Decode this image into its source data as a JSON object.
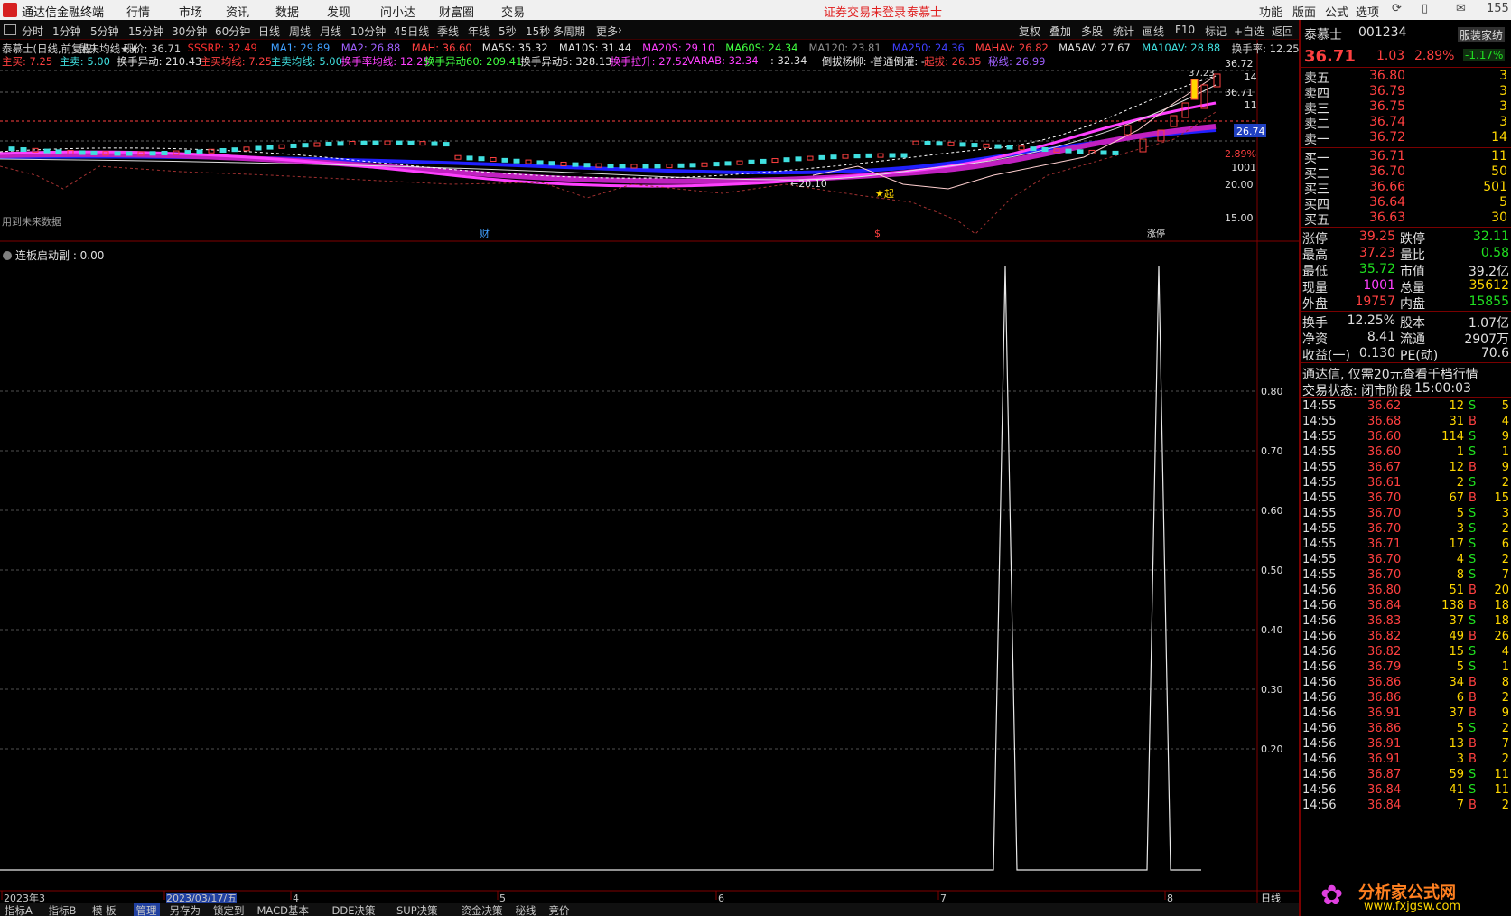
{
  "app": {
    "title": "通达信金融终端",
    "notice": "证券交易未登录",
    "user": "泰慕士",
    "corner": "155"
  },
  "menu": [
    "行情",
    "市场",
    "资讯",
    "数据",
    "发现",
    "问小达",
    "财富圈",
    "交易"
  ],
  "menu_right": [
    "功能",
    "版面",
    "公式",
    "选项"
  ],
  "periods": [
    "分时",
    "1分钟",
    "5分钟",
    "15分钟",
    "30分钟",
    "60分钟",
    "日线",
    "周线",
    "月线",
    "10分钟",
    "45日线",
    "季线",
    "年线",
    "5秒",
    "15秒",
    "多周期",
    "更多"
  ],
  "toolbar_right": [
    "复权",
    "叠加",
    "多股",
    "统计",
    "画线",
    "F10",
    "标记",
    "+自选",
    "返回"
  ],
  "main_chart": {
    "line1": [
      {
        "t": "泰慕士(日线,前复权)",
        "c": "#d0d0d0"
      },
      {
        "t": "鼠夫均线★★",
        "c": "#d0d0d0"
      },
      {
        "t": "现价: 36.71",
        "c": "#d0d0d0"
      },
      {
        "t": "SSSRP: 32.49",
        "c": "#ff3030"
      },
      {
        "t": "MA1: 29.89",
        "c": "#40a0ff"
      },
      {
        "t": "MA2: 26.88",
        "c": "#a060ff"
      },
      {
        "t": "MAH: 36.60",
        "c": "#ff4040"
      },
      {
        "t": "MA5S: 35.32",
        "c": "#e0e0e0"
      },
      {
        "t": "MA10S: 31.44",
        "c": "#e0e0e0"
      },
      {
        "t": "MA20S: 29.10",
        "c": "#ff40ff"
      },
      {
        "t": "MA60S: 24.34",
        "c": "#40ff40"
      },
      {
        "t": "MA120: 23.81",
        "c": "#909090"
      },
      {
        "t": "MA250: 24.36",
        "c": "#4040ff"
      },
      {
        "t": "MAHAV: 26.82",
        "c": "#ff4040"
      },
      {
        "t": "MA5AV: 27.67",
        "c": "#e0e0e0"
      },
      {
        "t": "MA10AV: 28.88",
        "c": "#40e0e0"
      },
      {
        "t": "换手率: 12.25",
        "c": "#d0d0d0"
      }
    ],
    "line2": [
      {
        "t": "主买: 7.25",
        "c": "#ff4040"
      },
      {
        "t": "主卖: 5.00",
        "c": "#40e0e0"
      },
      {
        "t": "换手异动: 210.43",
        "c": "#e0e0e0"
      },
      {
        "t": "主买均线: 7.25",
        "c": "#ff4040"
      },
      {
        "t": "主卖均线: 5.00",
        "c": "#40e0e0"
      },
      {
        "t": "换手率均线: 12.25",
        "c": "#ff40ff"
      },
      {
        "t": "换手异动60: 209.41",
        "c": "#40ff40"
      },
      {
        "t": "换手异动5: 328.13",
        "c": "#e0e0e0"
      },
      {
        "t": "换手拉升: 27.52",
        "c": "#ff40ff"
      },
      {
        "t": "VARAB: 32.34",
        "c": "#ff40ff"
      },
      {
        "t": ": 32.34",
        "c": "#e0e0e0"
      },
      {
        "t": "倒拔杨柳: -",
        "c": "#e0e0e0"
      },
      {
        "t": "普通倒灌: -",
        "c": "#e0e0e0"
      },
      {
        "t": "起拔: 26.35",
        "c": "#ff4040"
      },
      {
        "t": "秘线: 26.99",
        "c": "#a060ff"
      }
    ],
    "price_axis": [
      "36.72",
      "14",
      "36.71",
      "11",
      "26.74",
      "2.89%",
      "1001",
      "20.00",
      "15.00"
    ],
    "annotations": {
      "peak": "37.23",
      "low": "←20.10",
      "start": "★起",
      "note": "用到未来数据",
      "marker_cai": "财",
      "marker_s": "$",
      "marker_zt": "涨停"
    }
  },
  "sub_chart": {
    "title": "连板启动副 : 0.00",
    "yticks": [
      "0.80",
      "0.70",
      "0.60",
      "0.50",
      "0.40",
      "0.30",
      "0.20"
    ]
  },
  "date_axis": {
    "labels": [
      "2023年3",
      "2023/03/17/五",
      "4",
      "5",
      "6",
      "7",
      "8"
    ],
    "period": "日线"
  },
  "bottom_tabs": [
    "指标A",
    "指标B",
    "模 板",
    "管理",
    "另存为",
    "锁定到",
    "MACD基本",
    "DDE决策",
    "SUP决策",
    "资金决策",
    "秘线",
    "竞价"
  ],
  "right_panel": {
    "name": "泰慕士",
    "code": "001234",
    "price": "36.71",
    "change": "1.03",
    "pct": "2.89%",
    "industry": "服装家纺",
    "industry_pct": "-1.17%",
    "asks": [
      [
        "卖五",
        "36.80",
        "3"
      ],
      [
        "卖四",
        "36.79",
        "3"
      ],
      [
        "卖三",
        "36.75",
        "3"
      ],
      [
        "卖二",
        "36.74",
        "3"
      ],
      [
        "卖一",
        "36.72",
        "14"
      ]
    ],
    "bids": [
      [
        "买一",
        "36.71",
        "11"
      ],
      [
        "买二",
        "36.70",
        "50"
      ],
      [
        "买三",
        "36.66",
        "501"
      ],
      [
        "买四",
        "36.64",
        "5"
      ],
      [
        "买五",
        "36.63",
        "30"
      ]
    ],
    "stats": [
      [
        "涨停",
        "39.25",
        "跌停",
        "32.11"
      ],
      [
        "最高",
        "37.23",
        "量比",
        "0.58"
      ],
      [
        "最低",
        "35.72",
        "市值",
        "39.2亿"
      ],
      [
        "现量",
        "1001",
        "总量",
        "35612"
      ],
      [
        "外盘",
        "19757",
        "内盘",
        "15855"
      ]
    ],
    "stats2": [
      [
        "换手",
        "12.25%",
        "股本",
        "1.07亿"
      ],
      [
        "净资",
        "8.41",
        "流通",
        "2907万"
      ],
      [
        "收益(一)",
        "0.130",
        "PE(动)",
        "70.6"
      ]
    ],
    "promo": "通达信, 仅需20元查看千档行情",
    "status_label": "交易状态: 闭市阶段",
    "status_time": "15:00:03",
    "ticks": [
      [
        "14:55",
        "36.62",
        "12",
        "S",
        "5"
      ],
      [
        "14:55",
        "36.68",
        "31",
        "B",
        "4"
      ],
      [
        "14:55",
        "36.60",
        "114",
        "S",
        "9"
      ],
      [
        "14:55",
        "36.60",
        "1",
        "S",
        "1"
      ],
      [
        "14:55",
        "36.67",
        "12",
        "B",
        "9"
      ],
      [
        "14:55",
        "36.61",
        "2",
        "S",
        "2"
      ],
      [
        "14:55",
        "36.70",
        "67",
        "B",
        "15"
      ],
      [
        "14:55",
        "36.70",
        "5",
        "S",
        "3"
      ],
      [
        "14:55",
        "36.70",
        "3",
        "S",
        "2"
      ],
      [
        "14:55",
        "36.71",
        "17",
        "S",
        "6"
      ],
      [
        "14:55",
        "36.70",
        "4",
        "S",
        "2"
      ],
      [
        "14:55",
        "36.70",
        "8",
        "S",
        "7"
      ],
      [
        "14:56",
        "36.80",
        "51",
        "B",
        "20"
      ],
      [
        "14:56",
        "36.84",
        "138",
        "B",
        "18"
      ],
      [
        "14:56",
        "36.83",
        "37",
        "S",
        "18"
      ],
      [
        "14:56",
        "36.82",
        "49",
        "B",
        "26"
      ],
      [
        "14:56",
        "36.82",
        "15",
        "S",
        "4"
      ],
      [
        "14:56",
        "36.79",
        "5",
        "S",
        "1"
      ],
      [
        "14:56",
        "36.86",
        "34",
        "B",
        "8"
      ],
      [
        "14:56",
        "36.86",
        "6",
        "B",
        "2"
      ],
      [
        "14:56",
        "36.91",
        "37",
        "B",
        "9"
      ],
      [
        "14:56",
        "36.86",
        "5",
        "S",
        "2"
      ],
      [
        "14:56",
        "36.91",
        "13",
        "B",
        "7"
      ],
      [
        "14:56",
        "36.91",
        "3",
        "B",
        "2"
      ],
      [
        "14:56",
        "36.87",
        "59",
        "S",
        "11"
      ],
      [
        "14:56",
        "36.84",
        "41",
        "S",
        "11"
      ],
      [
        "14:56",
        "36.84",
        "7",
        "B",
        "2"
      ]
    ],
    "watermark": "分析家公式网",
    "watermark_url": "www.fxjgsw.com"
  }
}
